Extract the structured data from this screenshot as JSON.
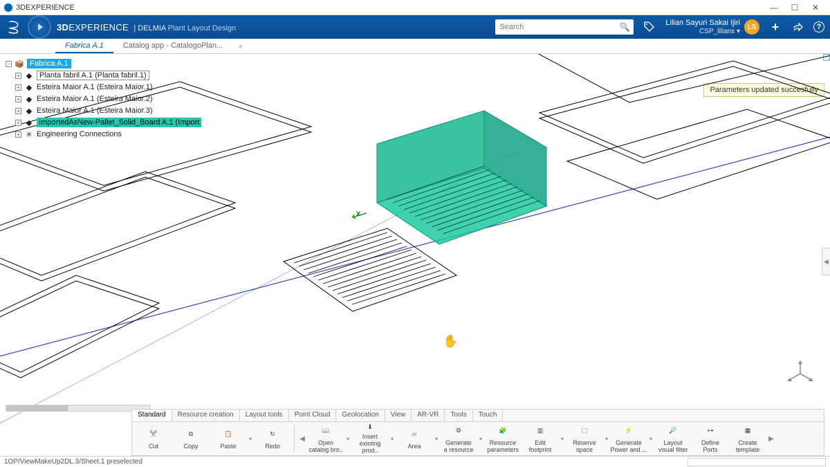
{
  "window": {
    "title": "3DEXPERIENCE"
  },
  "header": {
    "brand_bold": "3D",
    "brand_rest": "EXPERIENCE",
    "divider": " | ",
    "product": "DELMIA",
    "module": "Plant Layout Design",
    "search_placeholder": "Search",
    "user_name": "Lilian Sayuri Sakai Ijiri",
    "user_role": "CSP_lilians",
    "avatar_initials": "LS"
  },
  "doc_tabs": {
    "active": "Fabrica A.1",
    "inactive": "Catalog app - CatalogoPlan...",
    "add": "+"
  },
  "tree": {
    "root": "Fabrica A.1",
    "items": [
      "Planta fabril A.1 (Planta fabril.1)",
      "Esteira Maior A.1 (Esteira Maior.1)",
      "Esteira Maior A.1 (Esteira Maior.2)",
      "Esteira Maior A.1 (Esteira Maior.3)",
      "ImportedAsNew-Pallet_Solid_Board A.1 (Import",
      "Engineering Connections"
    ],
    "selected_index": 4
  },
  "tooltip": "Parameters updated succesfully",
  "axis_label": "x",
  "cmd_tabs": [
    "Standard",
    "Resource creation",
    "Layout tools",
    "Point Cloud",
    "Geolocation",
    "View",
    "AR-VR",
    "Tools",
    "Touch"
  ],
  "cmd_tab_active": 0,
  "commands_left": [
    {
      "id": "cut",
      "label": "Cut"
    },
    {
      "id": "copy",
      "label": "Copy"
    },
    {
      "id": "paste",
      "label": "Paste",
      "dd": true
    },
    {
      "id": "redo",
      "label": "Redo"
    }
  ],
  "commands_right": [
    {
      "id": "open-catalog",
      "label": "Open\ncatalog bro..",
      "dd": true
    },
    {
      "id": "insert-existing",
      "label": "Insert\nexisting prod..",
      "dd": true
    },
    {
      "id": "area",
      "label": "Area",
      "dd": true
    },
    {
      "id": "gen-resource",
      "label": "Generate\na resource",
      "dd": true
    },
    {
      "id": "res-params",
      "label": "Resource\nparameters"
    },
    {
      "id": "edit-footprint",
      "label": "Edit\nfootprint",
      "dd": true
    },
    {
      "id": "reserve-space",
      "label": "Reserve\nspace",
      "dd": true
    },
    {
      "id": "gen-power",
      "label": "Generate\nPower and ...",
      "dd": true
    },
    {
      "id": "visual-filter",
      "label": "Layout\nvisual filter"
    },
    {
      "id": "define-ports",
      "label": "Define\nPorts"
    },
    {
      "id": "create-template",
      "label": "Create\ntemplate"
    }
  ],
  "status": {
    "text": "1OP/ViewMakeUp2DL.3/Sheet.1 preselected"
  }
}
